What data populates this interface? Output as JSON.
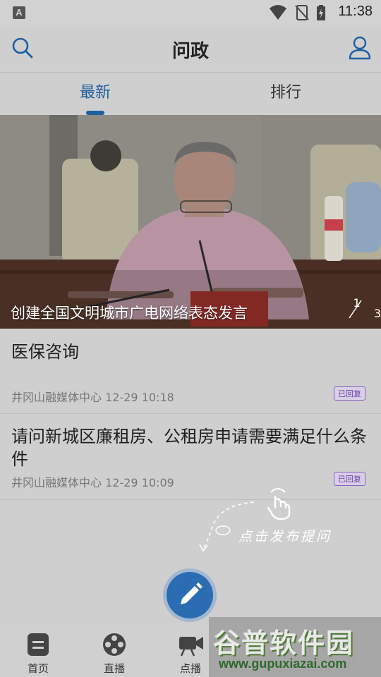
{
  "status_bar": {
    "time": "11:38"
  },
  "header": {
    "title": "问政"
  },
  "tabs": [
    {
      "label": "最新",
      "active": true
    },
    {
      "label": "排行",
      "active": false
    }
  ],
  "banner": {
    "caption": "创建全国文明城市广电网络表态发言",
    "page_current": "1",
    "page_total": "3"
  },
  "posts": [
    {
      "title": "医保咨询",
      "source": "井冈山融媒体中心",
      "time": "12-29 10:18",
      "status": "已回复"
    },
    {
      "title": "请问新城区廉租房、公租房申请需要满足什么条件",
      "source": "井冈山融媒体中心",
      "time": "12-29 10:09",
      "status": "已回复"
    }
  ],
  "hint": {
    "text": "点击发布提问"
  },
  "bottom_nav": [
    {
      "label": "首页",
      "icon": "document-icon"
    },
    {
      "label": "直播",
      "icon": "film-reel-icon"
    },
    {
      "label": "点播",
      "icon": "video-camera-icon"
    }
  ],
  "watermark": {
    "name": "谷普软件园",
    "url": "www.gupuxiazai.com"
  },
  "colors": {
    "accent": "#1e5fa0",
    "badge": "#6a3fa8",
    "background": "#cfcfcf"
  }
}
